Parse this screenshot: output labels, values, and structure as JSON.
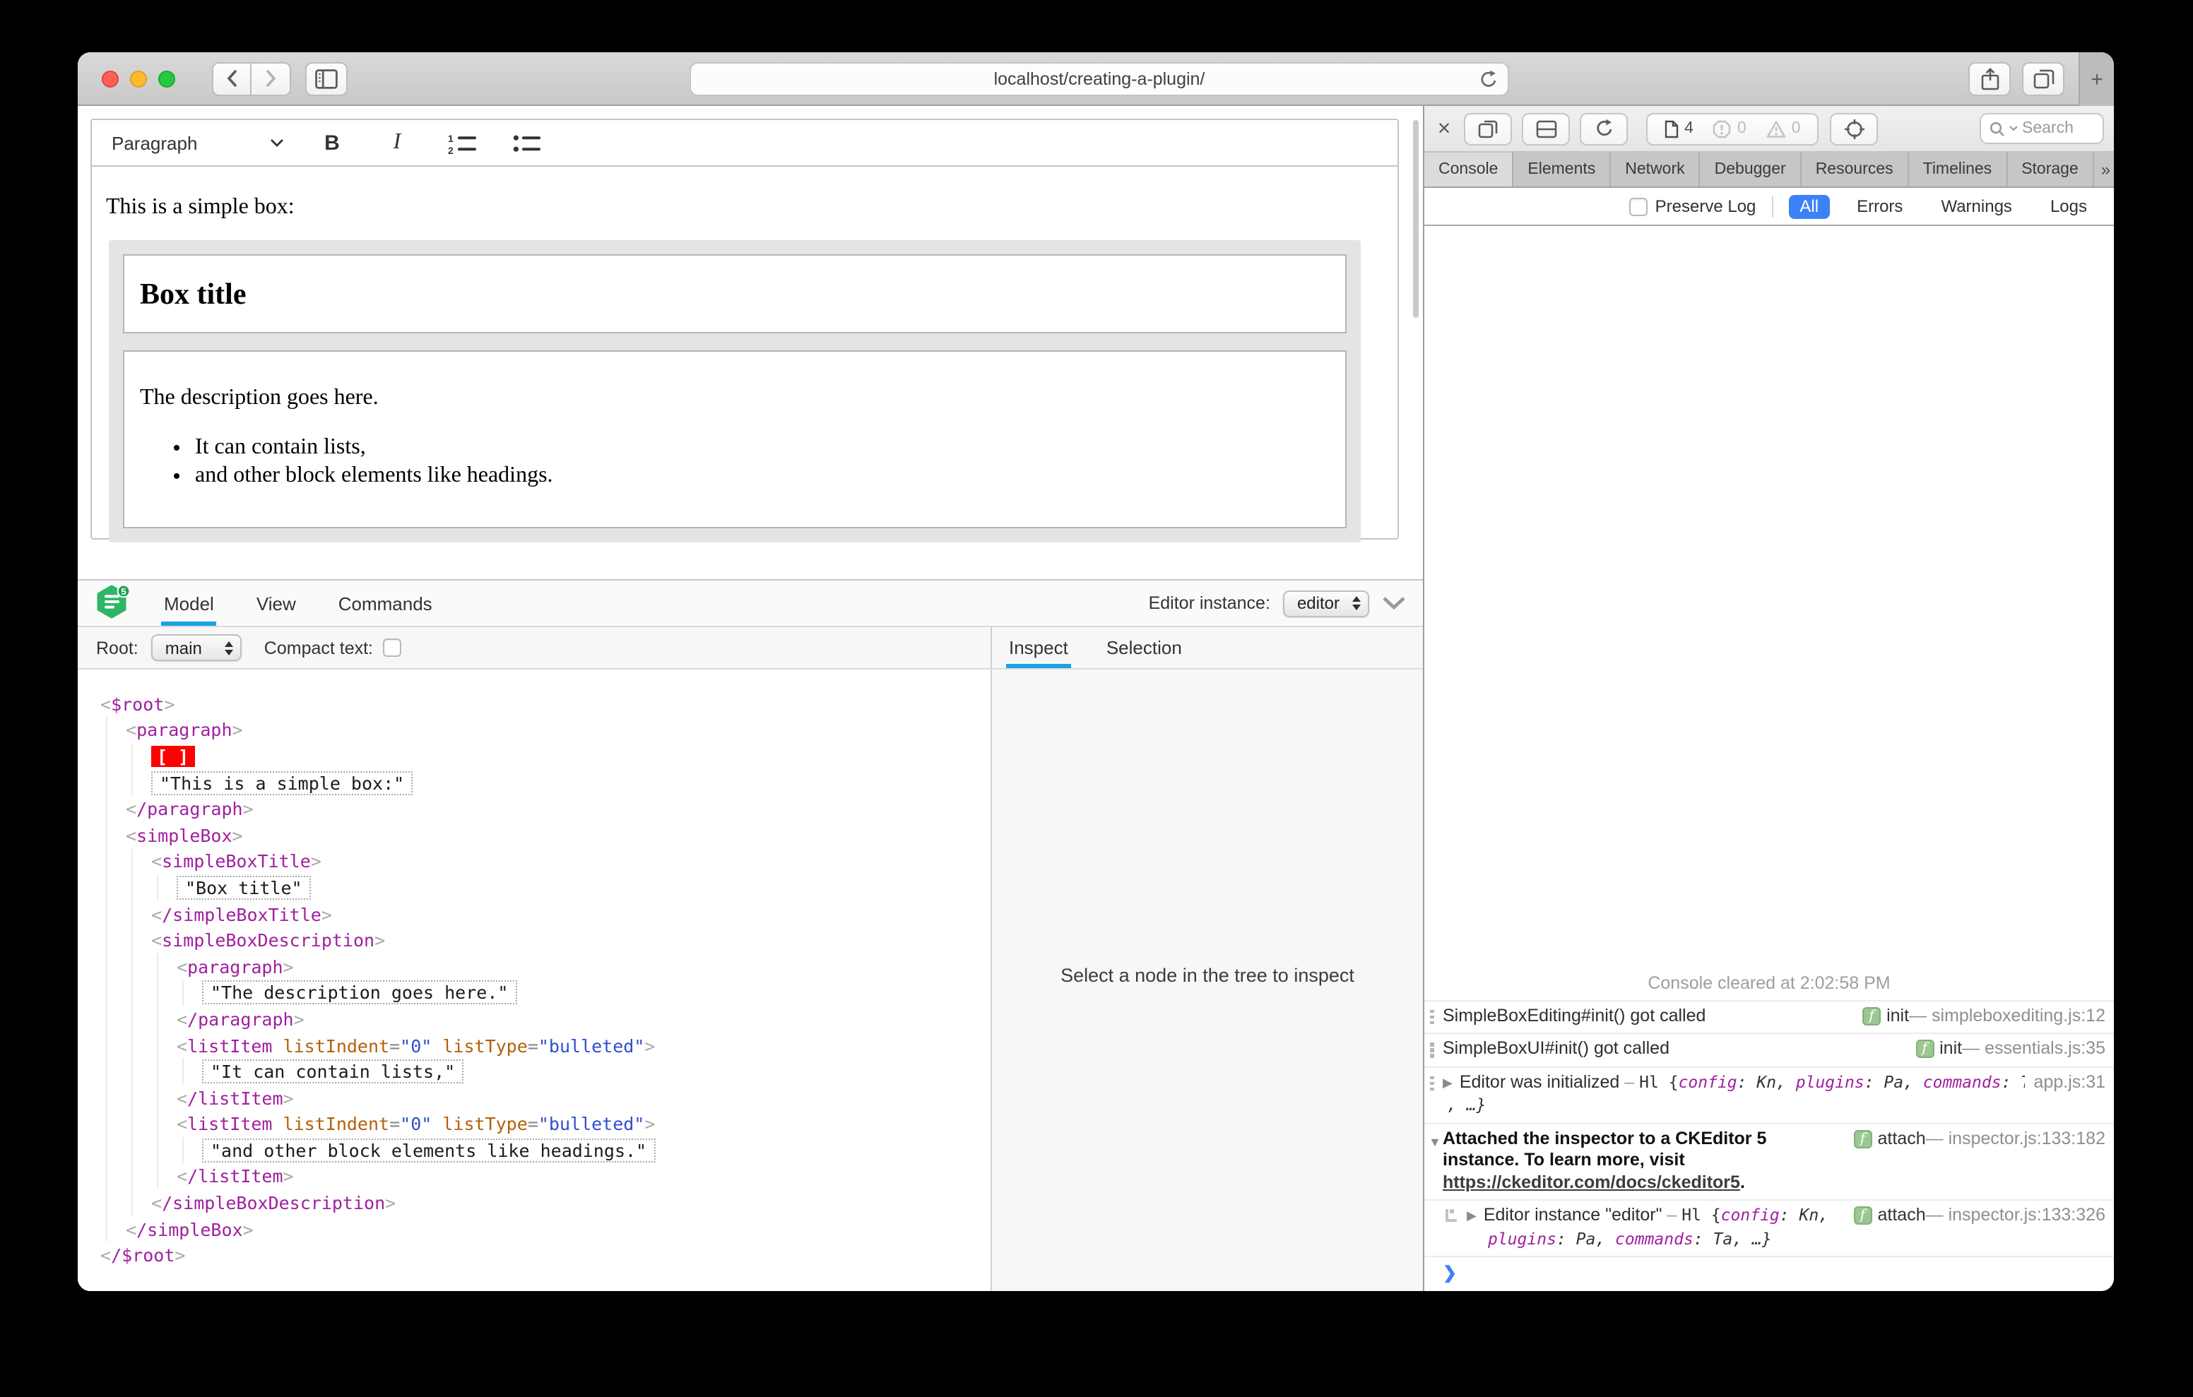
{
  "browser": {
    "url": "localhost/creating-a-plugin/",
    "new_tab_label": "+"
  },
  "editor": {
    "toolbar": {
      "paragraph_label": "Paragraph",
      "bold_label": "B",
      "italic_label": "I"
    },
    "content": {
      "intro": "This is a simple box:",
      "box_title": "Box title",
      "description": "The description goes here.",
      "bullets": [
        "It can contain lists,",
        "and other block elements like headings."
      ]
    }
  },
  "ck_inspector": {
    "logo_badge": "5",
    "tabs": [
      "Model",
      "View",
      "Commands"
    ],
    "active_tab": "Model",
    "editor_instance_label": "Editor instance:",
    "editor_instance_value": "editor",
    "root_label": "Root:",
    "root_value": "main",
    "compact_label": "Compact text:",
    "side_tabs": [
      "Inspect",
      "Selection"
    ],
    "side_active": "Inspect",
    "empty_message": "Select a node in the tree to inspect",
    "model_tree": {
      "tag": "$root",
      "children": [
        {
          "tag": "paragraph",
          "children": [
            {
              "marker": "[ ]"
            },
            {
              "text": "\"This is a simple box:\""
            }
          ]
        },
        {
          "tag": "simpleBox",
          "children": [
            {
              "tag": "simpleBoxTitle",
              "children": [
                {
                  "text": "\"Box title\""
                }
              ]
            },
            {
              "tag": "simpleBoxDescription",
              "children": [
                {
                  "tag": "paragraph",
                  "children": [
                    {
                      "text": "\"The description goes here.\""
                    }
                  ]
                },
                {
                  "tag": "listItem",
                  "attrs": [
                    {
                      "name": "listIndent",
                      "value": "\"0\""
                    },
                    {
                      "name": "listType",
                      "value": "\"bulleted\""
                    }
                  ],
                  "children": [
                    {
                      "text": "\"It can contain lists,\""
                    }
                  ]
                },
                {
                  "tag": "listItem",
                  "attrs": [
                    {
                      "name": "listIndent",
                      "value": "\"0\""
                    },
                    {
                      "name": "listType",
                      "value": "\"bulleted\""
                    }
                  ],
                  "children": [
                    {
                      "text": "\"and other block elements like headings.\""
                    }
                  ]
                }
              ]
            }
          ]
        }
      ]
    }
  },
  "web_inspector": {
    "badges": {
      "pages": "4",
      "errors": "0",
      "warnings": "0"
    },
    "search_placeholder": "Search",
    "tabs": [
      "Console",
      "Elements",
      "Network",
      "Debugger",
      "Resources",
      "Timelines",
      "Storage"
    ],
    "active_tab": "Console",
    "more_tabs_glyph": "»",
    "add_tab_glyph": "+",
    "filter": {
      "preserve_log": "Preserve Log",
      "options": [
        "All",
        "Errors",
        "Warnings",
        "Logs"
      ],
      "active": "All"
    },
    "console": {
      "cleared": "Console cleared at 2:02:58 PM",
      "meta_sep": " — ",
      "prompt": "❯",
      "messages": {
        "m1": {
          "text": "SimpleBoxEditing#init() got called",
          "badge": "f",
          "fn": "init",
          "loc": "simpleboxediting.js:12"
        },
        "m2": {
          "text": "SimpleBoxUI#init() got called",
          "badge": "f",
          "fn": "init",
          "loc": "essentials.js:35"
        },
        "m3": {
          "text": "Editor was initialized",
          "sep": " – ",
          "obj_open": "Hl {",
          "k1": "config",
          "v1": ": Kn, ",
          "k2": "plugins",
          "v2": ": Pa, ",
          "k3": "commands",
          "v3": ": Ta",
          "cont": ", …}",
          "loc": "app.js:31"
        },
        "m4": {
          "line1": "Attached the inspector to a CKEditor 5",
          "line2": "instance. To learn more, visit",
          "link": "https://ckeditor.com/docs/ckeditor5",
          "period": ".",
          "badge": "f",
          "fn": "attach",
          "loc": "inspector.js:133:182"
        },
        "m5": {
          "text": "Editor instance \"editor\"",
          "sep": " – ",
          "obj_open": "Hl {",
          "k1": "config",
          "v1": ": Kn,",
          "l2k1": "plugins",
          "l2v1": ": Pa, ",
          "l2k2": "commands",
          "l2v2": ": Ta, …}",
          "badge": "f",
          "fn": "attach",
          "loc": "inspector.js:133:326"
        }
      }
    }
  },
  "colors": {
    "accent_blue": "#18a3e6",
    "safari_blue": "#3c82f7",
    "selection_red": "#ff0000",
    "badge_green_bg": "#9cc793",
    "badge_green_border": "#7fb375",
    "tag_purple": "#a0209e",
    "attr_orange": "#b4600a",
    "attr_value_blue": "#2d4fd0",
    "ck_green": "#2eb566"
  }
}
